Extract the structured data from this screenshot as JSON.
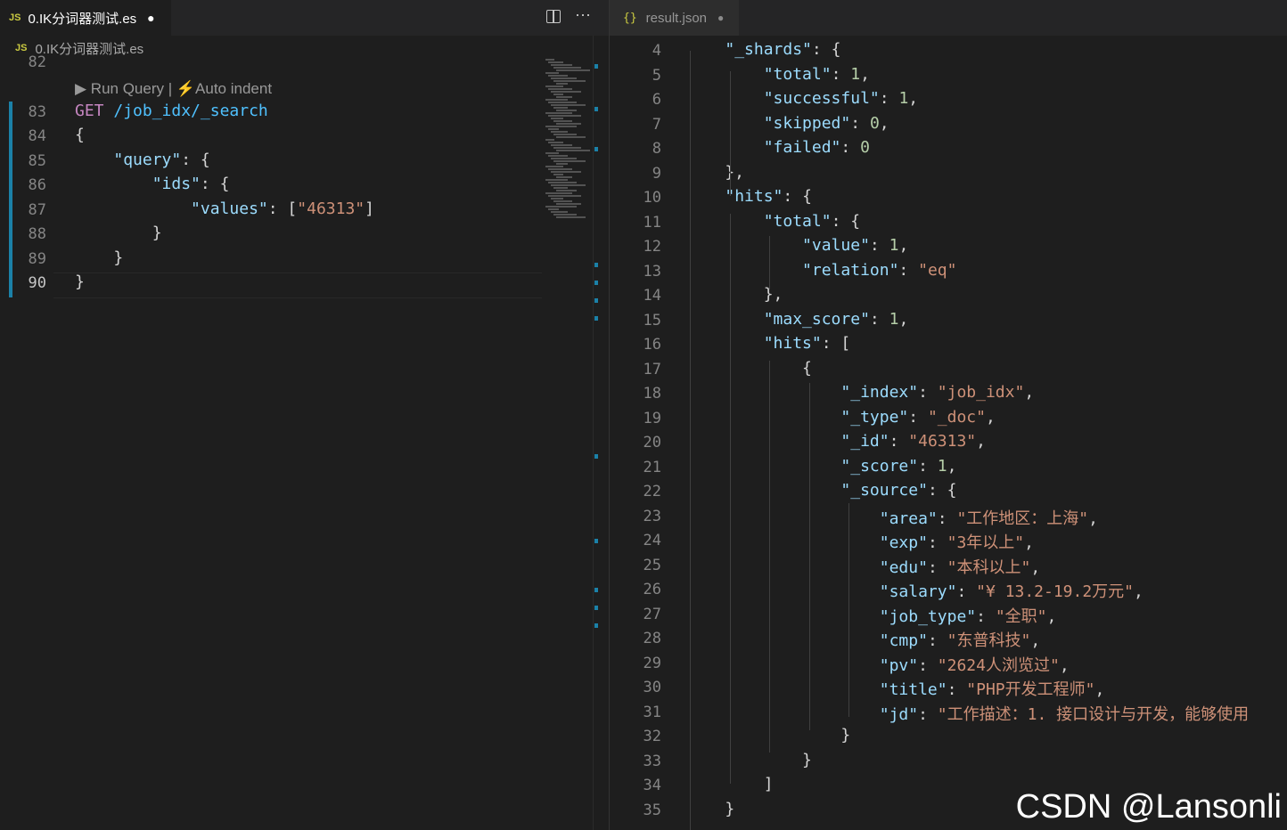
{
  "left_tab": {
    "badge": "JS",
    "title": "0.IK分词器测试.es",
    "modified": "●"
  },
  "breadcrumb": {
    "badge": "JS",
    "text": "0.IK分词器测试.es"
  },
  "codelens": {
    "run": "▶ Run Query |",
    "auto": "⚡Auto indent"
  },
  "left_lines": [
    {
      "n": "82",
      "segs": []
    },
    {
      "n": "83",
      "segs": [
        {
          "c": "k-get",
          "t": "GET "
        },
        {
          "c": "k-path",
          "t": "/job_idx/_search"
        }
      ]
    },
    {
      "n": "84",
      "segs": [
        {
          "c": "k-pun",
          "t": "{"
        }
      ]
    },
    {
      "n": "85",
      "segs": [
        {
          "c": "k-pun",
          "t": "    "
        },
        {
          "c": "k-key",
          "t": "\"query\""
        },
        {
          "c": "k-pun",
          "t": ": {"
        }
      ]
    },
    {
      "n": "86",
      "segs": [
        {
          "c": "k-pun",
          "t": "        "
        },
        {
          "c": "k-key",
          "t": "\"ids\""
        },
        {
          "c": "k-pun",
          "t": ": {"
        }
      ]
    },
    {
      "n": "87",
      "segs": [
        {
          "c": "k-pun",
          "t": "            "
        },
        {
          "c": "k-key",
          "t": "\"values\""
        },
        {
          "c": "k-pun",
          "t": ": ["
        },
        {
          "c": "k-str",
          "t": "\"46313\""
        },
        {
          "c": "k-pun",
          "t": "]"
        }
      ]
    },
    {
      "n": "88",
      "segs": [
        {
          "c": "k-pun",
          "t": "        }"
        }
      ]
    },
    {
      "n": "89",
      "segs": [
        {
          "c": "k-pun",
          "t": "    }"
        }
      ]
    },
    {
      "n": "90",
      "segs": [
        {
          "c": "k-pun",
          "t": "}"
        }
      ]
    }
  ],
  "right_tab": {
    "badge": "{}",
    "title": "result.json",
    "dot": "●"
  },
  "right_lines": [
    {
      "n": "4",
      "segs": [
        {
          "c": "k-pun",
          "t": "    "
        },
        {
          "c": "k-key",
          "t": "\"_shards\""
        },
        {
          "c": "k-pun",
          "t": ": {"
        }
      ]
    },
    {
      "n": "5",
      "segs": [
        {
          "c": "k-pun",
          "t": "        "
        },
        {
          "c": "k-key",
          "t": "\"total\""
        },
        {
          "c": "k-pun",
          "t": ": "
        },
        {
          "c": "k-num",
          "t": "1"
        },
        {
          "c": "k-pun",
          "t": ","
        }
      ]
    },
    {
      "n": "6",
      "segs": [
        {
          "c": "k-pun",
          "t": "        "
        },
        {
          "c": "k-key",
          "t": "\"successful\""
        },
        {
          "c": "k-pun",
          "t": ": "
        },
        {
          "c": "k-num",
          "t": "1"
        },
        {
          "c": "k-pun",
          "t": ","
        }
      ]
    },
    {
      "n": "7",
      "segs": [
        {
          "c": "k-pun",
          "t": "        "
        },
        {
          "c": "k-key",
          "t": "\"skipped\""
        },
        {
          "c": "k-pun",
          "t": ": "
        },
        {
          "c": "k-num",
          "t": "0"
        },
        {
          "c": "k-pun",
          "t": ","
        }
      ]
    },
    {
      "n": "8",
      "segs": [
        {
          "c": "k-pun",
          "t": "        "
        },
        {
          "c": "k-key",
          "t": "\"failed\""
        },
        {
          "c": "k-pun",
          "t": ": "
        },
        {
          "c": "k-num",
          "t": "0"
        }
      ]
    },
    {
      "n": "9",
      "segs": [
        {
          "c": "k-pun",
          "t": "    },"
        }
      ]
    },
    {
      "n": "10",
      "segs": [
        {
          "c": "k-pun",
          "t": "    "
        },
        {
          "c": "k-key",
          "t": "\"hits\""
        },
        {
          "c": "k-pun",
          "t": ": {"
        }
      ]
    },
    {
      "n": "11",
      "segs": [
        {
          "c": "k-pun",
          "t": "        "
        },
        {
          "c": "k-key",
          "t": "\"total\""
        },
        {
          "c": "k-pun",
          "t": ": {"
        }
      ]
    },
    {
      "n": "12",
      "segs": [
        {
          "c": "k-pun",
          "t": "            "
        },
        {
          "c": "k-key",
          "t": "\"value\""
        },
        {
          "c": "k-pun",
          "t": ": "
        },
        {
          "c": "k-num",
          "t": "1"
        },
        {
          "c": "k-pun",
          "t": ","
        }
      ]
    },
    {
      "n": "13",
      "segs": [
        {
          "c": "k-pun",
          "t": "            "
        },
        {
          "c": "k-key",
          "t": "\"relation\""
        },
        {
          "c": "k-pun",
          "t": ": "
        },
        {
          "c": "k-str",
          "t": "\"eq\""
        }
      ]
    },
    {
      "n": "14",
      "segs": [
        {
          "c": "k-pun",
          "t": "        },"
        }
      ]
    },
    {
      "n": "15",
      "segs": [
        {
          "c": "k-pun",
          "t": "        "
        },
        {
          "c": "k-key",
          "t": "\"max_score\""
        },
        {
          "c": "k-pun",
          "t": ": "
        },
        {
          "c": "k-num",
          "t": "1"
        },
        {
          "c": "k-pun",
          "t": ","
        }
      ]
    },
    {
      "n": "16",
      "segs": [
        {
          "c": "k-pun",
          "t": "        "
        },
        {
          "c": "k-key",
          "t": "\"hits\""
        },
        {
          "c": "k-pun",
          "t": ": ["
        }
      ]
    },
    {
      "n": "17",
      "segs": [
        {
          "c": "k-pun",
          "t": "            {"
        }
      ]
    },
    {
      "n": "18",
      "segs": [
        {
          "c": "k-pun",
          "t": "                "
        },
        {
          "c": "k-key",
          "t": "\"_index\""
        },
        {
          "c": "k-pun",
          "t": ": "
        },
        {
          "c": "k-str",
          "t": "\"job_idx\""
        },
        {
          "c": "k-pun",
          "t": ","
        }
      ]
    },
    {
      "n": "19",
      "segs": [
        {
          "c": "k-pun",
          "t": "                "
        },
        {
          "c": "k-key",
          "t": "\"_type\""
        },
        {
          "c": "k-pun",
          "t": ": "
        },
        {
          "c": "k-str",
          "t": "\"_doc\""
        },
        {
          "c": "k-pun",
          "t": ","
        }
      ]
    },
    {
      "n": "20",
      "segs": [
        {
          "c": "k-pun",
          "t": "                "
        },
        {
          "c": "k-key",
          "t": "\"_id\""
        },
        {
          "c": "k-pun",
          "t": ": "
        },
        {
          "c": "k-str",
          "t": "\"46313\""
        },
        {
          "c": "k-pun",
          "t": ","
        }
      ]
    },
    {
      "n": "21",
      "segs": [
        {
          "c": "k-pun",
          "t": "                "
        },
        {
          "c": "k-key",
          "t": "\"_score\""
        },
        {
          "c": "k-pun",
          "t": ": "
        },
        {
          "c": "k-num",
          "t": "1"
        },
        {
          "c": "k-pun",
          "t": ","
        }
      ]
    },
    {
      "n": "22",
      "segs": [
        {
          "c": "k-pun",
          "t": "                "
        },
        {
          "c": "k-key",
          "t": "\"_source\""
        },
        {
          "c": "k-pun",
          "t": ": {"
        }
      ]
    },
    {
      "n": "23",
      "segs": [
        {
          "c": "k-pun",
          "t": "                    "
        },
        {
          "c": "k-key",
          "t": "\"area\""
        },
        {
          "c": "k-pun",
          "t": ": "
        },
        {
          "c": "k-str",
          "t": "\"工作地区：上海\""
        },
        {
          "c": "k-pun",
          "t": ","
        }
      ]
    },
    {
      "n": "24",
      "segs": [
        {
          "c": "k-pun",
          "t": "                    "
        },
        {
          "c": "k-key",
          "t": "\"exp\""
        },
        {
          "c": "k-pun",
          "t": ": "
        },
        {
          "c": "k-str",
          "t": "\"3年以上\""
        },
        {
          "c": "k-pun",
          "t": ","
        }
      ]
    },
    {
      "n": "25",
      "segs": [
        {
          "c": "k-pun",
          "t": "                    "
        },
        {
          "c": "k-key",
          "t": "\"edu\""
        },
        {
          "c": "k-pun",
          "t": ": "
        },
        {
          "c": "k-str",
          "t": "\"本科以上\""
        },
        {
          "c": "k-pun",
          "t": ","
        }
      ]
    },
    {
      "n": "26",
      "segs": [
        {
          "c": "k-pun",
          "t": "                    "
        },
        {
          "c": "k-key",
          "t": "\"salary\""
        },
        {
          "c": "k-pun",
          "t": ": "
        },
        {
          "c": "k-str",
          "t": "\"¥ 13.2-19.2万元\""
        },
        {
          "c": "k-pun",
          "t": ","
        }
      ]
    },
    {
      "n": "27",
      "segs": [
        {
          "c": "k-pun",
          "t": "                    "
        },
        {
          "c": "k-key",
          "t": "\"job_type\""
        },
        {
          "c": "k-pun",
          "t": ": "
        },
        {
          "c": "k-str",
          "t": "\"全职\""
        },
        {
          "c": "k-pun",
          "t": ","
        }
      ]
    },
    {
      "n": "28",
      "segs": [
        {
          "c": "k-pun",
          "t": "                    "
        },
        {
          "c": "k-key",
          "t": "\"cmp\""
        },
        {
          "c": "k-pun",
          "t": ": "
        },
        {
          "c": "k-str",
          "t": "\"东普科技\""
        },
        {
          "c": "k-pun",
          "t": ","
        }
      ]
    },
    {
      "n": "29",
      "segs": [
        {
          "c": "k-pun",
          "t": "                    "
        },
        {
          "c": "k-key",
          "t": "\"pv\""
        },
        {
          "c": "k-pun",
          "t": ": "
        },
        {
          "c": "k-str",
          "t": "\"2624人浏览过\""
        },
        {
          "c": "k-pun",
          "t": ","
        }
      ]
    },
    {
      "n": "30",
      "segs": [
        {
          "c": "k-pun",
          "t": "                    "
        },
        {
          "c": "k-key",
          "t": "\"title\""
        },
        {
          "c": "k-pun",
          "t": ": "
        },
        {
          "c": "k-str",
          "t": "\"PHP开发工程师\""
        },
        {
          "c": "k-pun",
          "t": ","
        }
      ]
    },
    {
      "n": "31",
      "segs": [
        {
          "c": "k-pun",
          "t": "                    "
        },
        {
          "c": "k-key",
          "t": "\"jd\""
        },
        {
          "c": "k-pun",
          "t": ": "
        },
        {
          "c": "k-str",
          "t": "\"工作描述：1. 接口设计与开发，能够使用"
        }
      ]
    },
    {
      "n": "32",
      "segs": [
        {
          "c": "k-pun",
          "t": "                }"
        }
      ]
    },
    {
      "n": "33",
      "segs": [
        {
          "c": "k-pun",
          "t": "            }"
        }
      ]
    },
    {
      "n": "34",
      "segs": [
        {
          "c": "k-pun",
          "t": "        ]"
        }
      ]
    },
    {
      "n": "35",
      "segs": [
        {
          "c": "k-pun",
          "t": "    }"
        }
      ]
    }
  ],
  "watermark": "CSDN @Lansonli"
}
